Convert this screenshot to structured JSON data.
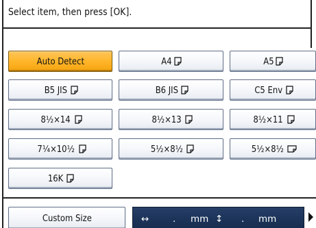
{
  "prompt": "Select item, then press [OK].",
  "paper_sizes": [
    {
      "label": "Auto Detect",
      "selected": true,
      "icon": ""
    },
    {
      "label": "A4",
      "selected": false,
      "icon": "portrait-paper-icon"
    },
    {
      "label": "A5",
      "selected": false,
      "icon": "portrait-paper-icon"
    },
    {
      "label": "B5 JIS",
      "selected": false,
      "icon": "portrait-paper-icon"
    },
    {
      "label": "B6 JIS",
      "selected": false,
      "icon": "portrait-paper-icon"
    },
    {
      "label": "C5 Env",
      "selected": false,
      "icon": "portrait-paper-icon"
    },
    {
      "label": "8½×14",
      "selected": false,
      "icon": "portrait-paper-icon"
    },
    {
      "label": "8½×13",
      "selected": false,
      "icon": "portrait-paper-icon"
    },
    {
      "label": "8½×11",
      "selected": false,
      "icon": "portrait-paper-icon"
    },
    {
      "label": "7¼×10½",
      "selected": false,
      "icon": "portrait-paper-icon"
    },
    {
      "label": "5½×8½",
      "selected": false,
      "icon": "portrait-paper-icon"
    },
    {
      "label": "5½×8½",
      "selected": false,
      "icon": "landscape-paper-icon"
    },
    {
      "label": "16K",
      "selected": false,
      "icon": "portrait-paper-icon"
    }
  ],
  "custom_size": {
    "button_label": "Custom Size",
    "horizontal_symbol": "↔",
    "horizontal_value": ".",
    "horizontal_unit": "mm",
    "vertical_symbol": "↕",
    "vertical_value": ".",
    "vertical_unit": "mm"
  },
  "colors": {
    "selected": "#ffb426",
    "field_background": "#1c3358"
  }
}
